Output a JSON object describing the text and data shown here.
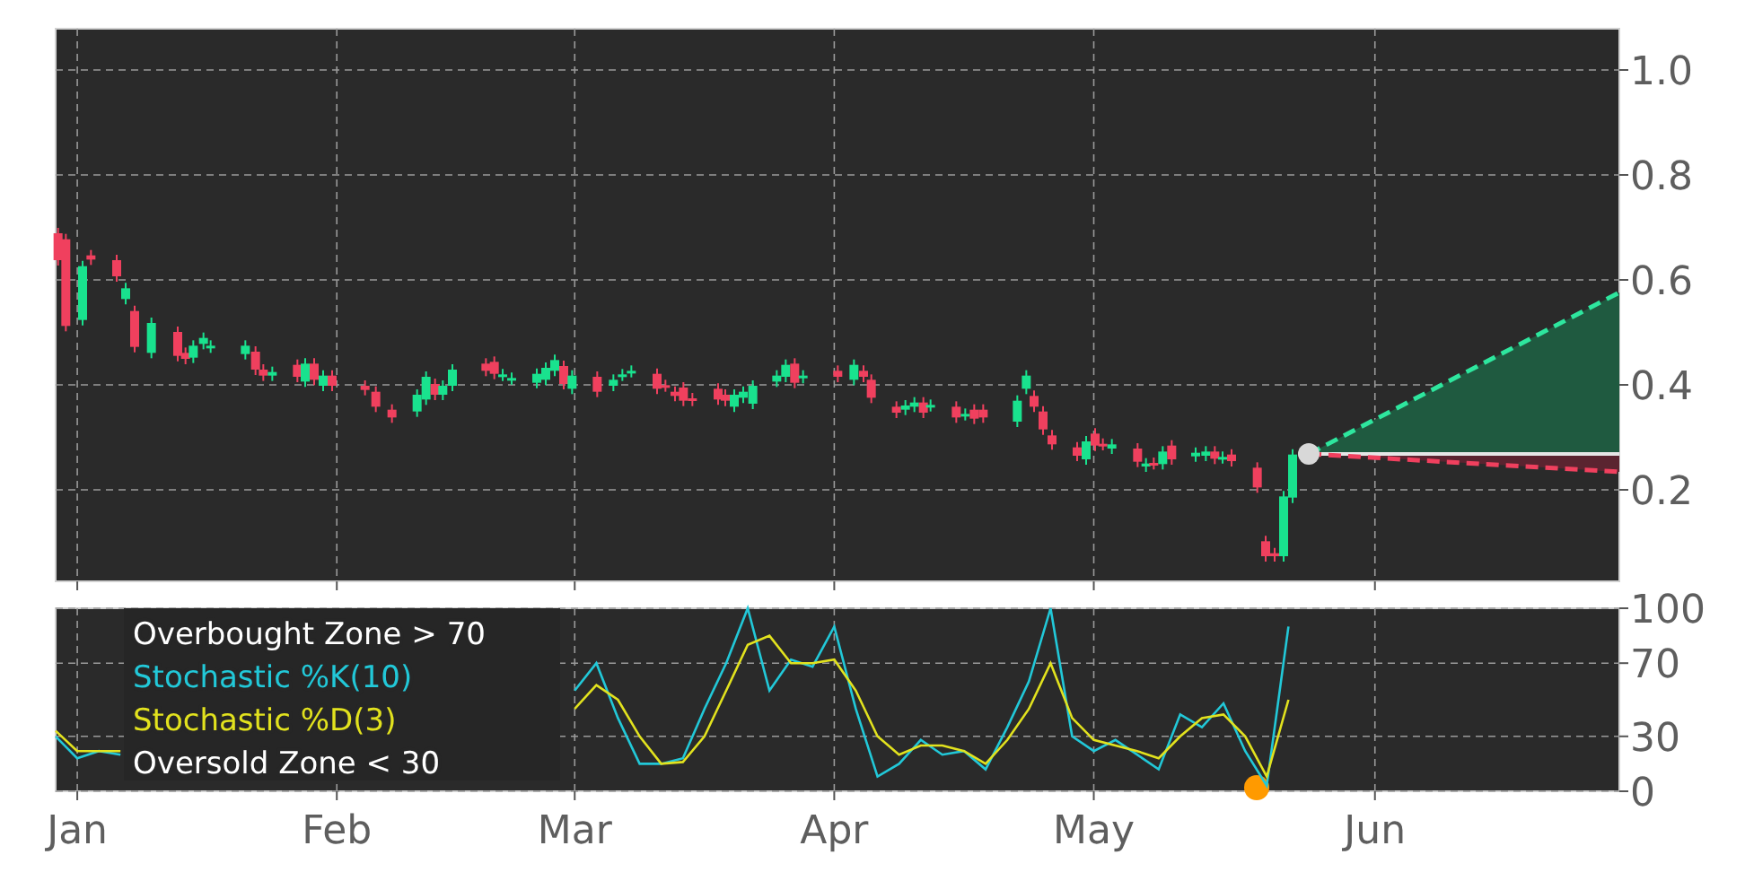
{
  "price_chart": {
    "yticks": [
      "1.0",
      "0.8",
      "0.6",
      "0.4",
      "0.2"
    ]
  },
  "stochastic_chart": {
    "overbought_label": "Overbought Zone > 70",
    "oversold_label": "Oversold Zone < 30",
    "chart_data": {
      "type": "line",
      "grid": true,
      "ylim": [
        0,
        100
      ],
      "categories": [
        null,
        "Jan",
        null,
        null,
        null,
        null,
        null,
        null,
        null,
        null,
        null,
        null,
        null,
        "Feb",
        null,
        null,
        null,
        null,
        null,
        null,
        null,
        null,
        null,
        null,
        "Mar",
        null,
        null,
        null,
        null,
        null,
        null,
        null,
        null,
        null,
        null,
        null,
        "Apr",
        null,
        null,
        null,
        null,
        null,
        null,
        null,
        null,
        null,
        null,
        null,
        "May",
        null,
        null,
        null,
        null,
        null,
        null,
        null,
        null,
        null,
        null,
        null,
        null,
        "Jun",
        null,
        null,
        null,
        null,
        null,
        null,
        null,
        null,
        null,
        null,
        null
      ],
      "yticks": [
        {
          "value": 0,
          "label": "0"
        },
        {
          "value": 30,
          "label": "30"
        },
        {
          "value": 70,
          "label": "70"
        },
        {
          "value": 100,
          "label": "100"
        }
      ],
      "series": [
        {
          "name": "Stochastic %K(10)",
          "color": "#22c8d8",
          "values": [
            30,
            18,
            22,
            20,
            null,
            null,
            null,
            null,
            null,
            null,
            null,
            null,
            null,
            null,
            null,
            null,
            null,
            null,
            null,
            null,
            null,
            null,
            null,
            null,
            55,
            70,
            40,
            15,
            15,
            18,
            45,
            70,
            100,
            55,
            72,
            68,
            90,
            45,
            8,
            15,
            28,
            20,
            22,
            12,
            35,
            60,
            100,
            30,
            22,
            28,
            20,
            12,
            42,
            35,
            48,
            22,
            3,
            90,
            null,
            null,
            null,
            null,
            null,
            null,
            null,
            null,
            null,
            null,
            null,
            null,
            null,
            null,
            null
          ]
        },
        {
          "name": "Stochastic %D(3)",
          "color": "#e2e21e",
          "values": [
            33,
            22,
            22,
            22,
            null,
            null,
            null,
            null,
            null,
            null,
            null,
            null,
            null,
            null,
            null,
            null,
            null,
            null,
            null,
            null,
            null,
            null,
            null,
            null,
            45,
            58,
            50,
            30,
            15,
            16,
            30,
            55,
            80,
            85,
            70,
            70,
            72,
            55,
            30,
            20,
            25,
            25,
            22,
            15,
            28,
            45,
            70,
            40,
            28,
            25,
            22,
            18,
            30,
            40,
            42,
            30,
            8,
            50,
            null,
            null,
            null,
            null,
            null,
            null,
            null,
            null,
            null,
            null,
            null,
            null,
            null,
            null,
            null
          ]
        }
      ]
    }
  }
}
